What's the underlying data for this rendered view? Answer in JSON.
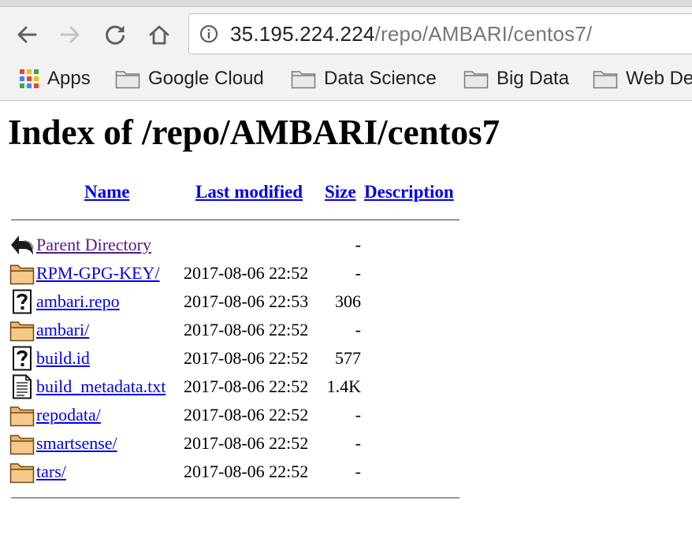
{
  "browser": {
    "url_host": "35.195.224.224",
    "url_path": "/repo/AMBARI/centos7/",
    "bookmarks": [
      {
        "label": "Apps",
        "icon": "apps-grid-icon"
      },
      {
        "label": "Google Cloud",
        "icon": "folder-icon"
      },
      {
        "label": "Data Science",
        "icon": "folder-icon"
      },
      {
        "label": "Big Data",
        "icon": "folder-icon"
      },
      {
        "label": "Web De",
        "icon": "folder-icon"
      }
    ],
    "nav_icons": [
      "back-arrow-icon",
      "forward-arrow-icon",
      "reload-icon",
      "home-icon",
      "info-icon"
    ],
    "apps_colors": [
      "#ea4335",
      "#fbbc05",
      "#34a853",
      "#4285f4"
    ]
  },
  "page": {
    "title": "Index of /repo/AMBARI/centos7",
    "columns": {
      "name": "Name",
      "modified": "Last modified",
      "size": "Size",
      "description": "Description"
    },
    "rows": [
      {
        "name": "Parent Directory",
        "modified": "",
        "size": "-",
        "icon": "back-icon",
        "visited": true
      },
      {
        "name": "RPM-GPG-KEY/",
        "modified": "2017-08-06 22:52",
        "size": "-",
        "icon": "folder-icon"
      },
      {
        "name": "ambari.repo",
        "modified": "2017-08-06 22:53",
        "size": "306",
        "icon": "unknown-file-icon"
      },
      {
        "name": "ambari/",
        "modified": "2017-08-06 22:52",
        "size": "-",
        "icon": "folder-icon"
      },
      {
        "name": "build.id",
        "modified": "2017-08-06 22:52",
        "size": "577",
        "icon": "unknown-file-icon"
      },
      {
        "name": "build_metadata.txt",
        "modified": "2017-08-06 22:52",
        "size": "1.4K",
        "icon": "text-file-icon"
      },
      {
        "name": "repodata/",
        "modified": "2017-08-06 22:52",
        "size": "-",
        "icon": "folder-icon"
      },
      {
        "name": "smartsense/",
        "modified": "2017-08-06 22:52",
        "size": "-",
        "icon": "folder-icon"
      },
      {
        "name": "tars/",
        "modified": "2017-08-06 22:52",
        "size": "-",
        "icon": "folder-icon"
      }
    ],
    "link_color": "#0000ee",
    "visited_color": "#551a8b"
  }
}
